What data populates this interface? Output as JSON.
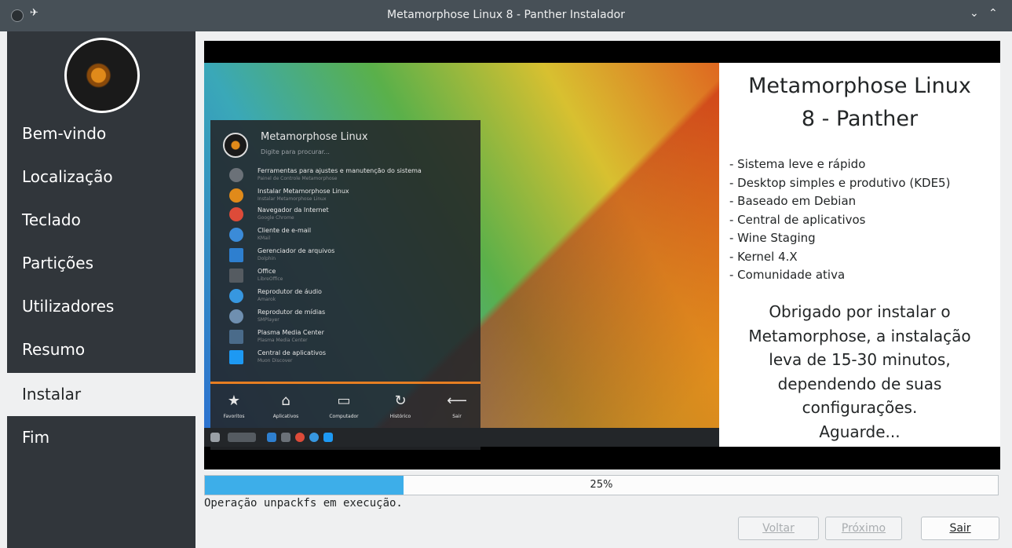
{
  "window": {
    "title": "Metamorphose Linux 8 - Panther Instalador"
  },
  "sidebar": {
    "items": [
      {
        "label": "Bem-vindo"
      },
      {
        "label": "Localização"
      },
      {
        "label": "Teclado"
      },
      {
        "label": "Partições"
      },
      {
        "label": "Utilizadores"
      },
      {
        "label": "Resumo"
      },
      {
        "label": "Instalar",
        "active": true
      },
      {
        "label": "Fim"
      }
    ]
  },
  "slide": {
    "screenshot_menu": {
      "title": "Metamorphose Linux",
      "search": "Digite para procurar...",
      "items": [
        {
          "title": "Ferramentas para ajustes e manutenção do sistema",
          "sub": "Painel de Controle Metamorphose"
        },
        {
          "title": "Instalar Metamorphose Linux",
          "sub": "Instalar Metamorphose Linux"
        },
        {
          "title": "Navegador da Internet",
          "sub": "Google Chrome"
        },
        {
          "title": "Cliente de e-mail",
          "sub": "KMail"
        },
        {
          "title": "Gerenciador de arquivos",
          "sub": "Dolphin"
        },
        {
          "title": "Office",
          "sub": "LibreOffice"
        },
        {
          "title": "Reprodutor de áudio",
          "sub": "Amarok"
        },
        {
          "title": "Reprodutor de mídias",
          "sub": "SMPlayer"
        },
        {
          "title": "Plasma Media Center",
          "sub": "Plasma Media Center"
        },
        {
          "title": "Central de aplicativos",
          "sub": "Muon Discover"
        }
      ],
      "tabs": [
        "Favoritos",
        "Aplicativos",
        "Computador",
        "Histórico",
        "Sair"
      ]
    },
    "panel": {
      "heading_line1": "Metamorphose Linux",
      "heading_line2": "8 - Panther",
      "features": [
        "- Sistema leve e rápido",
        "- Desktop simples e produtivo (KDE5)",
        "- Baseado em Debian",
        "- Central de aplicativos",
        "- Wine Staging",
        "- Kernel 4.X",
        "- Comunidade ativa"
      ],
      "thanks": [
        "Obrigado por instalar o",
        "Metamorphose, a instalação",
        "leva de 15-30 minutos,",
        "dependendo de suas",
        "configurações.",
        "Aguarde..."
      ]
    }
  },
  "progress": {
    "value_percent": 25,
    "label": "25%"
  },
  "status_text": "Operação unpackfs em execução.",
  "buttons": {
    "back": "Voltar",
    "next": "Próximo",
    "quit": "Sair"
  },
  "colors": {
    "sidebar": "#31363b",
    "accent": "#3daee9",
    "titlebar": "#475057"
  }
}
